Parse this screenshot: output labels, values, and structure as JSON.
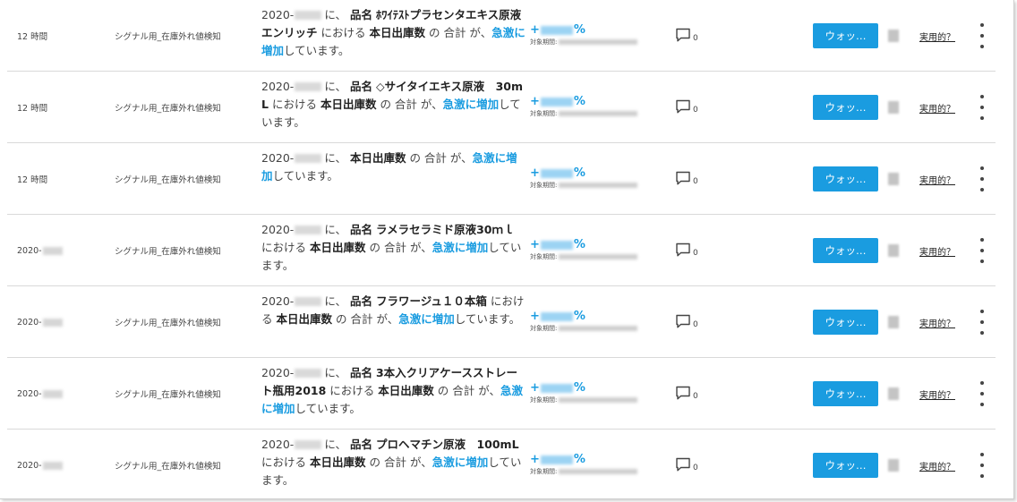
{
  "alerts": [
    {
      "time": "12 時間",
      "time_suffix": "",
      "signal": "シグナル用_在庫外れ値検知",
      "date": "2020-",
      "ni": "に、",
      "name_label": "品名",
      "product": "ﾎﾜｲﾃｽﾄプラセンタエキス原液エンリッチ",
      "mid": "における",
      "metric": "本日出庫数",
      "of": "の 合計 が、",
      "trend": "急激に増加",
      "tail": "しています。",
      "percent_prefix": "+",
      "percent_suffix": "%",
      "period_label": "対象期間:",
      "comments": "0",
      "action_label": "ウォッ…",
      "useful_label": "実用的？"
    },
    {
      "time": "12 時間",
      "time_suffix": "",
      "signal": "シグナル用_在庫外れ値検知",
      "date": "2020-",
      "ni": "に、",
      "name_label": "品名",
      "product": "◇サイタイエキス原液　30mL",
      "mid": "における",
      "metric": "本日出庫数",
      "of": "の 合計 が、",
      "trend": "急激に増加",
      "tail": "しています。",
      "percent_prefix": "+",
      "percent_suffix": "%",
      "period_label": "対象期間:",
      "comments": "0",
      "action_label": "ウォッ…",
      "useful_label": "実用的？"
    },
    {
      "time": "12 時間",
      "time_suffix": "",
      "signal": "シグナル用_在庫外れ値検知",
      "date": "2020-",
      "ni": "に、",
      "name_label": "",
      "product": "",
      "mid": "",
      "metric": "本日出庫数",
      "of": "の 合計 が、",
      "trend": "急激に増加",
      "tail": "しています。",
      "percent_prefix": "+",
      "percent_suffix": "%",
      "period_label": "対象期間:",
      "comments": "0",
      "action_label": "ウォッ…",
      "useful_label": "実用的？"
    },
    {
      "time": "2020-",
      "time_suffix": "",
      "signal": "シグナル用_在庫外れ値検知",
      "date": "2020-",
      "ni": "に、",
      "name_label": "品名",
      "product": "ラメラセラミド原液30ｍｌ",
      "mid": "における",
      "metric": "本日出庫数",
      "of": "の 合計 が、",
      "trend": "急激に増加",
      "tail": "しています。",
      "percent_prefix": "+",
      "percent_suffix": "%",
      "period_label": "対象期間:",
      "comments": "0",
      "action_label": "ウォッ…",
      "useful_label": "実用的？"
    },
    {
      "time": "2020-",
      "time_suffix": "",
      "signal": "シグナル用_在庫外れ値検知",
      "date": "2020-",
      "ni": "に、",
      "name_label": "品名",
      "product": "フラワージュ１０本箱",
      "mid": "における",
      "metric": "本日出庫数",
      "of": "の 合計 が、",
      "trend": "急激に増加",
      "tail": "しています。",
      "percent_prefix": "+",
      "percent_suffix": "%",
      "period_label": "対象期間:",
      "comments": "0",
      "action_label": "ウォッ…",
      "useful_label": "実用的？"
    },
    {
      "time": "2020-",
      "time_suffix": "",
      "signal": "シグナル用_在庫外れ値検知",
      "date": "2020-",
      "ni": "に、",
      "name_label": "品名",
      "product": "3本入クリアケースストレート瓶用2018",
      "mid": "における",
      "metric": "本日出庫数",
      "of": "の 合計 が、",
      "trend": "急激に増加",
      "tail": "しています。",
      "percent_prefix": "+",
      "percent_suffix": "%",
      "period_label": "対象期間:",
      "comments": "0",
      "action_label": "ウォッ…",
      "useful_label": "実用的？"
    },
    {
      "time": "2020-",
      "time_suffix": "",
      "signal": "シグナル用_在庫外れ値検知",
      "date": "2020-",
      "ni": "に、",
      "name_label": "品名",
      "product": "プロヘマチン原液　100mL",
      "mid": "における",
      "metric": "本日出庫数",
      "of": "の 合計 が、",
      "trend": "急激に増加",
      "tail": "しています。",
      "percent_prefix": "+",
      "percent_suffix": "%",
      "period_label": "対象期間:",
      "comments": "0",
      "action_label": "ウォッ…",
      "useful_label": "実用的？"
    }
  ],
  "colors": {
    "accent": "#1a9ce0",
    "divider": "#d9d9d9"
  },
  "icons": {
    "comment": "comment-icon",
    "more": "more-vert-icon"
  }
}
